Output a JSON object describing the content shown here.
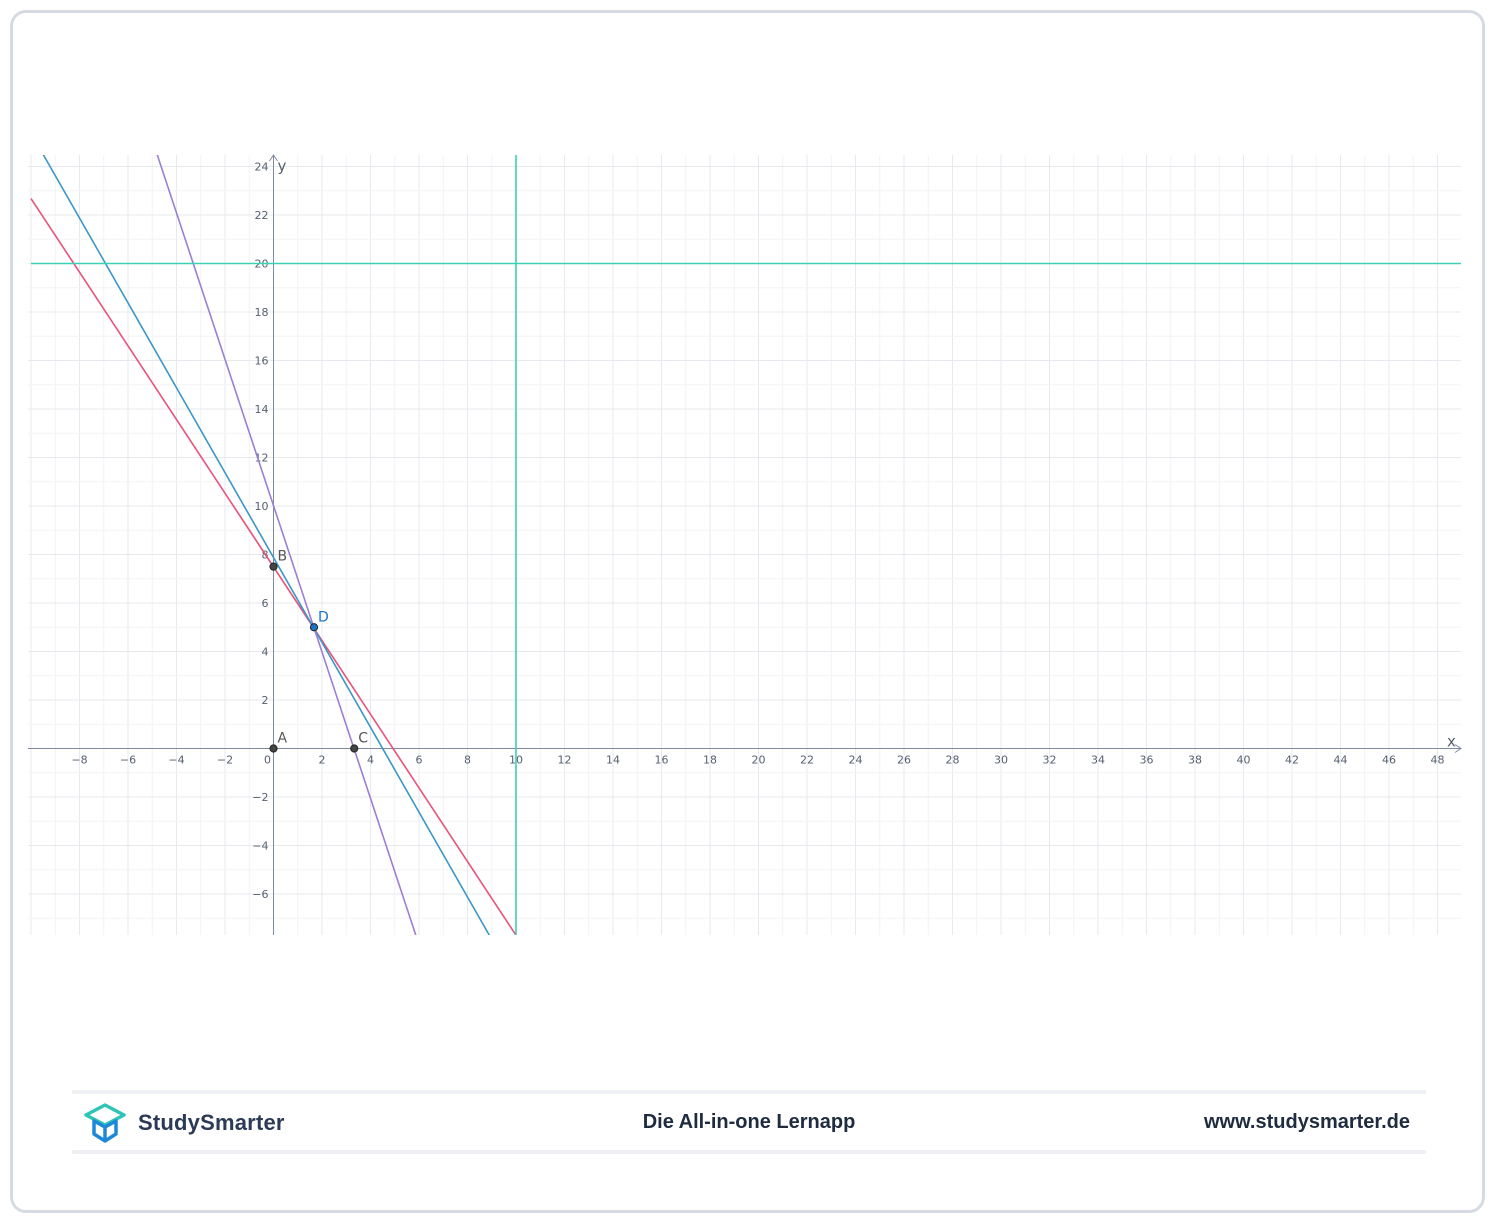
{
  "chart_data": {
    "type": "line",
    "xlabel": "x",
    "ylabel": "y",
    "xlim": [
      -10,
      49
    ],
    "ylim": [
      -7.7,
      24.5
    ],
    "x_ticks": [
      -8,
      -6,
      -4,
      -2,
      0,
      2,
      4,
      6,
      8,
      10,
      12,
      14,
      16,
      18,
      20,
      22,
      24,
      26,
      28,
      30,
      32,
      34,
      36,
      38,
      40,
      42,
      44,
      46,
      48
    ],
    "y_ticks": [
      -6,
      -4,
      -2,
      2,
      4,
      6,
      8,
      10,
      12,
      14,
      16,
      18,
      20,
      22,
      24
    ],
    "grid": true,
    "series": [
      {
        "color": "#e8527a",
        "points": [
          [
            -10,
            22.68
          ],
          [
            10,
            -7.7
          ]
        ]
      },
      {
        "color": "#3b97c7",
        "points": [
          [
            -9.5,
            24.5
          ],
          [
            8.9,
            -7.7
          ]
        ]
      },
      {
        "color": "#9b7fd4",
        "points": [
          [
            -4.8,
            24.5
          ],
          [
            5.87,
            -7.7
          ]
        ]
      },
      {
        "color": "#3ad1b4",
        "points": [
          [
            -10,
            20
          ],
          [
            49,
            20
          ]
        ]
      },
      {
        "color": "#3ad1b4",
        "points": [
          [
            10,
            -7.7
          ],
          [
            10,
            24.5
          ]
        ]
      }
    ],
    "points": [
      {
        "label": "A",
        "x": 0,
        "y": 0,
        "color": "#555555"
      },
      {
        "label": "B",
        "x": 0,
        "y": 7.5,
        "color": "#555555"
      },
      {
        "label": "C",
        "x": 3.33,
        "y": 0,
        "color": "#555555"
      },
      {
        "label": "D",
        "x": 1.67,
        "y": 5,
        "color": "#1a73c7"
      }
    ]
  },
  "footer": {
    "brand": "StudySmarter",
    "tagline": "Die All-in-one Lernapp",
    "website": "www.studysmarter.de"
  },
  "colors": {
    "frame_border": "#d6dbe3",
    "brand_teal": "#2ec4b6",
    "brand_blue": "#1e88d8",
    "footer_text": "#1f2b3f"
  }
}
